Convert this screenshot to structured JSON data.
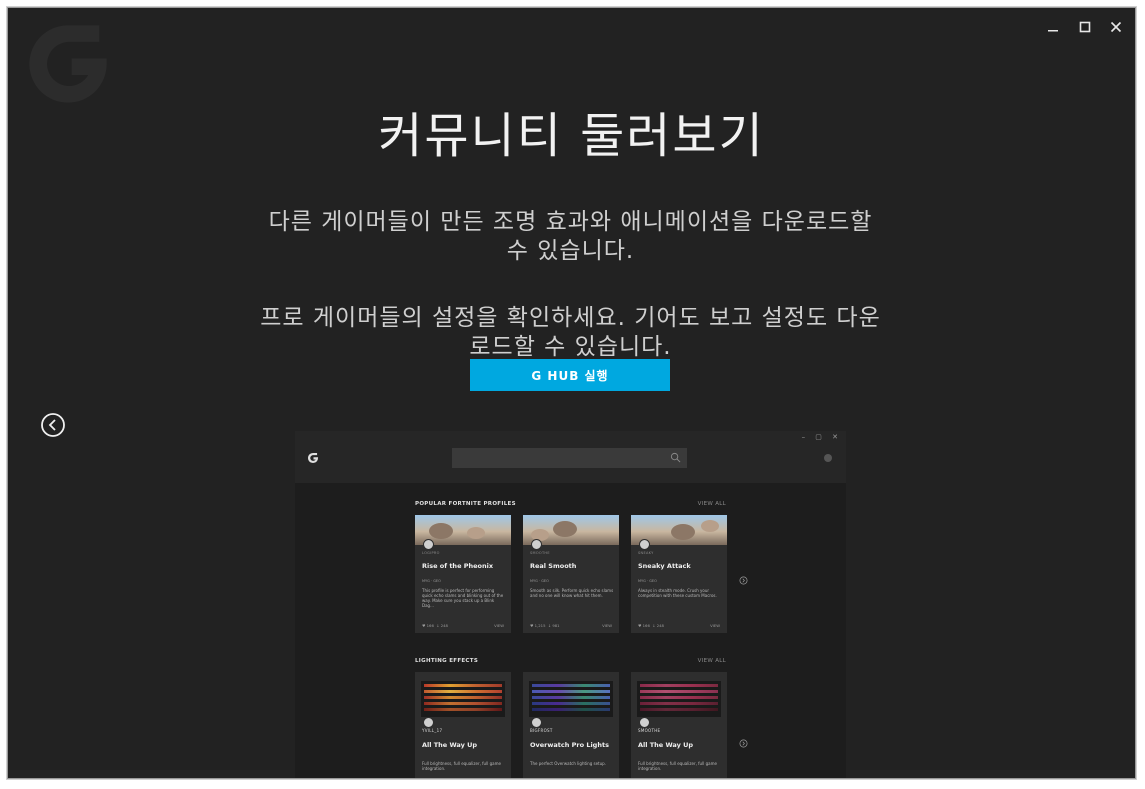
{
  "window": {
    "minimize_icon": "minimize-icon",
    "maximize_icon": "maximize-icon",
    "close_icon": "close-icon"
  },
  "main": {
    "title": "커뮤니티 둘러보기",
    "paragraph1": "다른 게이머들이 만든 조명 효과와 애니메이션을 다운로드할 수 있습니다.",
    "paragraph2": "프로 게이머들의 설정을 확인하세요. 기어도 보고 설정도 다운로드할 수 있습니다.",
    "launch_button": "G HUB 실행"
  },
  "colors": {
    "background": "#222222",
    "accent": "#00a8e0",
    "text": "#f2f2f2"
  },
  "preview": {
    "window_controls": "– ▢ ✕",
    "popular": {
      "heading": "POPULAR FORTNITE PROFILES",
      "view_all": "VIEW ALL",
      "cards": [
        {
          "author": "LOGIPRO",
          "title": "Rise of the Pheonix",
          "meta": "MYG · GEO",
          "desc": "This profile is perfect for performing quick echo slams and blinking out of the way. Make sure you stack up a Blink Dag...",
          "likes": "166",
          "downloads": "248",
          "view": "VIEW"
        },
        {
          "author": "SMOOTHE",
          "title": "Real Smooth",
          "meta": "MYG · GEO",
          "desc": "Smooth as silk. Perform quick echo slams and no one will know what hit them.",
          "likes": "1,215",
          "downloads": "981",
          "view": "VIEW"
        },
        {
          "author": "SNEAKY",
          "title": "Sneaky Attack",
          "meta": "MYG · GEO",
          "desc": "Always in stealth mode. Crush your competition with these custom Macros.",
          "likes": "166",
          "downloads": "248",
          "view": "VIEW"
        }
      ]
    },
    "lighting": {
      "heading": "LIGHTING EFFECTS",
      "view_all": "VIEW ALL",
      "cards": [
        {
          "author": "YVILL_17",
          "title": "All The Way Up",
          "desc": "Full brightness, full equalizer, full game integration."
        },
        {
          "author": "BIGFROST",
          "title": "Overwatch Pro Lights",
          "desc": "The perfect Overwatch lighting setup."
        },
        {
          "author": "SMOOTHE",
          "title": "All The Way Up",
          "desc": "Full brightness, full equalizer, full game integration."
        }
      ]
    }
  }
}
